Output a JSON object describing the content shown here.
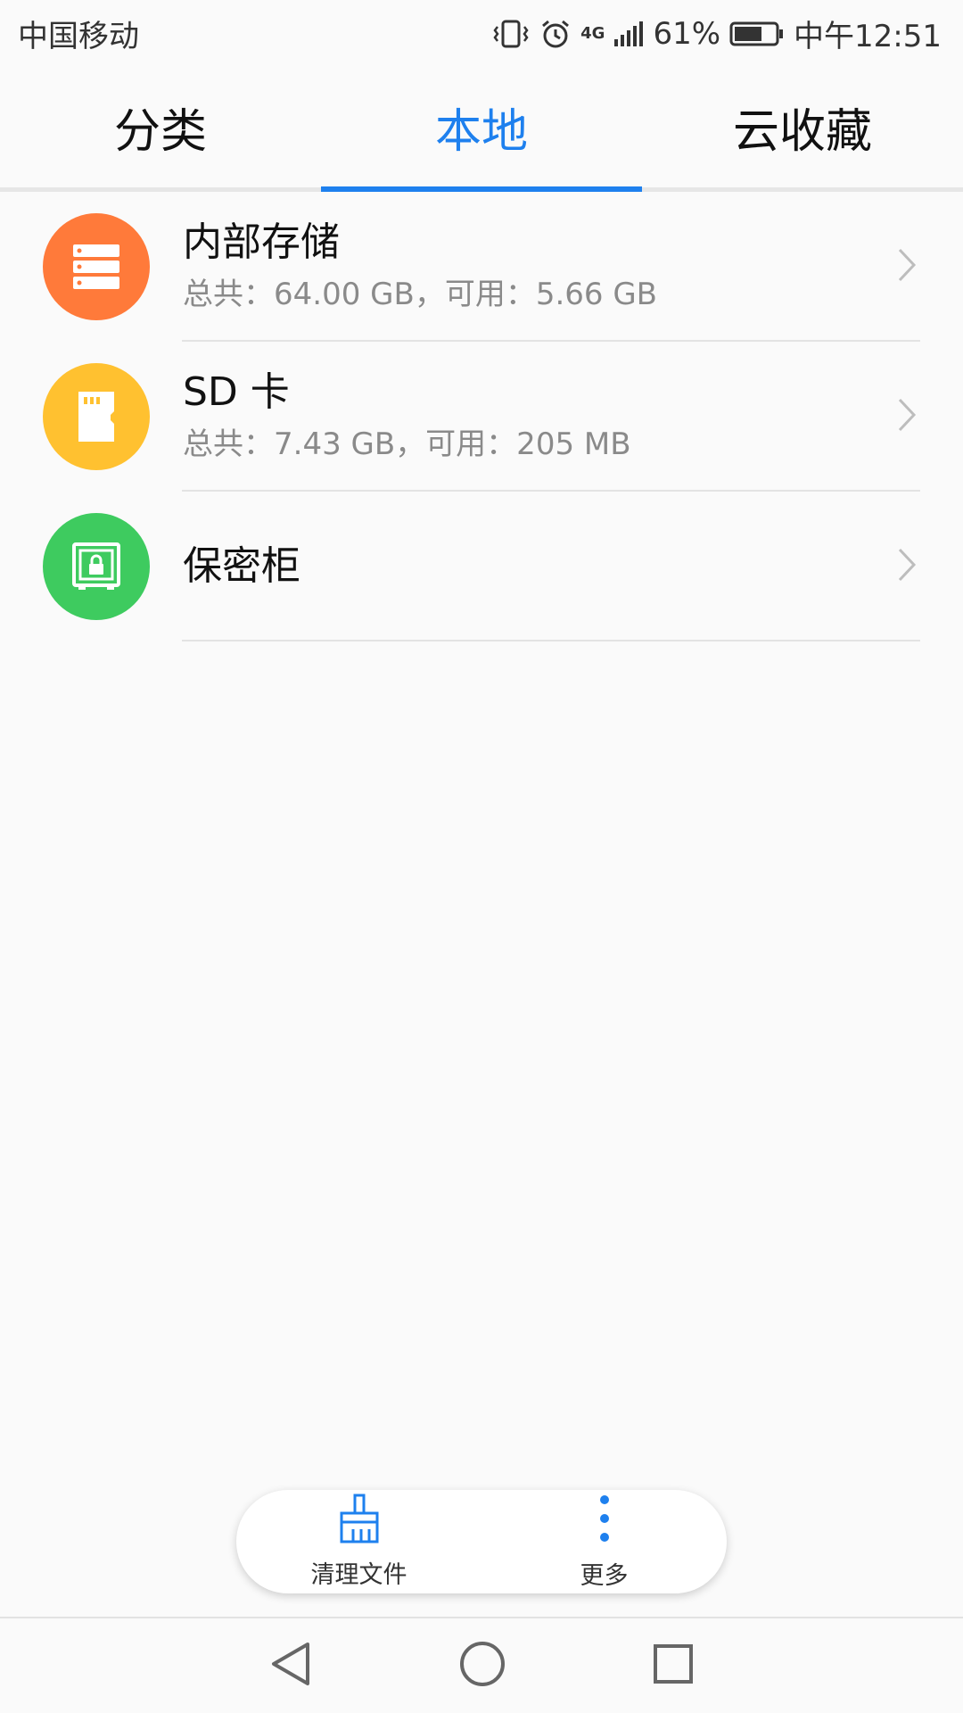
{
  "status_bar": {
    "carrier": "中国移动",
    "network": "4G",
    "battery_percent": "61%",
    "time": "中午12:51",
    "icons": [
      "vibrate-icon",
      "alarm-icon",
      "signal-icon",
      "battery-icon"
    ]
  },
  "tabs": [
    {
      "label": "分类",
      "active": false
    },
    {
      "label": "本地",
      "active": true
    },
    {
      "label": "云收藏",
      "active": false
    }
  ],
  "storage_list": [
    {
      "title": "内部存储",
      "subtitle": "总共：64.00 GB，可用：5.66 GB",
      "icon": "server-icon",
      "color": "#ff7a3a"
    },
    {
      "title": "SD 卡",
      "subtitle": "总共：7.43 GB，可用：205 MB",
      "icon": "sd-card-icon",
      "color": "#ffc130"
    },
    {
      "title": "保密柜",
      "subtitle": "",
      "icon": "safe-lock-icon",
      "color": "#3ecb5f"
    }
  ],
  "bottom_actions": [
    {
      "label": "清理文件",
      "icon": "broom-icon"
    },
    {
      "label": "更多",
      "icon": "more-vertical-icon"
    }
  ],
  "accent_color": "#1e80ee",
  "nav_icons": [
    "back-icon",
    "home-icon",
    "recents-icon"
  ]
}
